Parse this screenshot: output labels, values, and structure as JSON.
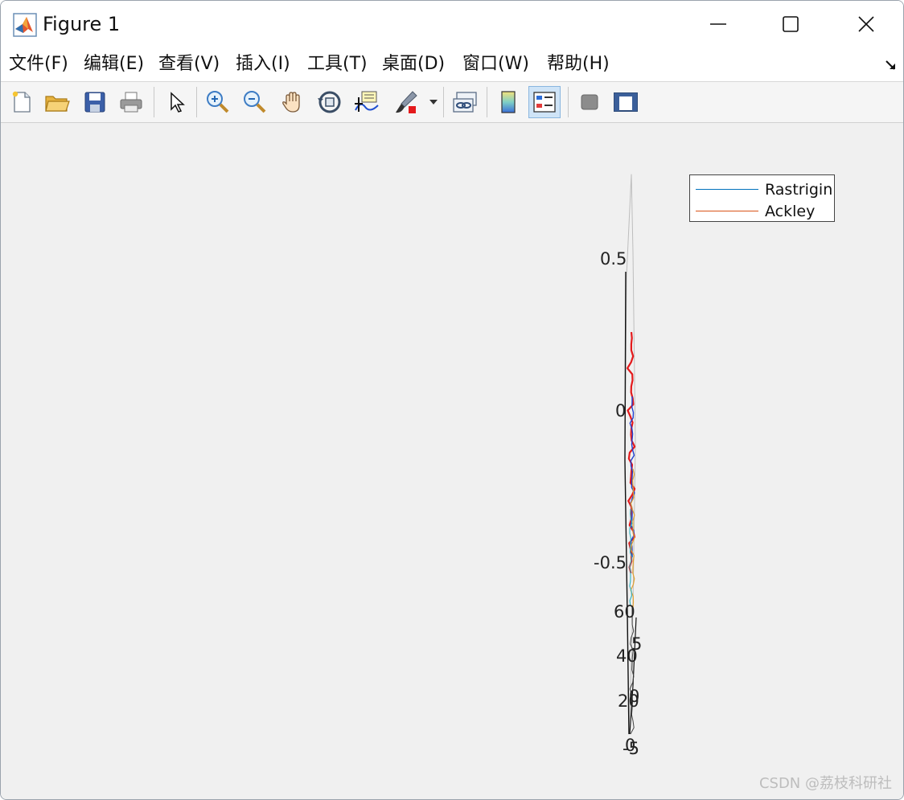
{
  "window": {
    "title": "Figure 1"
  },
  "menu": {
    "items": [
      {
        "label": "文件(F)"
      },
      {
        "label": "编辑(E)"
      },
      {
        "label": "查看(V)"
      },
      {
        "label": "插入(I)"
      },
      {
        "label": "工具(T)"
      },
      {
        "label": "桌面(D)"
      },
      {
        "label": "窗口(W)"
      },
      {
        "label": "帮助(H)"
      }
    ]
  },
  "toolbar": {
    "icons": [
      "new-figure-icon",
      "open-file-icon",
      "save-icon",
      "print-icon",
      "pointer-icon",
      "zoom-in-icon",
      "zoom-out-icon",
      "pan-icon",
      "rotate-3d-icon",
      "data-cursor-icon",
      "brush-icon",
      "link-plot-icon",
      "colorbar-icon",
      "legend-icon",
      "hide-plot-tools-icon",
      "show-plot-tools-icon"
    ],
    "active": "legend-icon"
  },
  "chart_data": {
    "type": "line",
    "series": [
      {
        "name": "Rastrigin",
        "color": "#0072BD"
      },
      {
        "name": "Ackley",
        "color": "#D95319"
      }
    ],
    "z_ticks": [
      "0.5",
      "0",
      "-0.5"
    ],
    "y_ticks": [
      "60",
      "40",
      "20",
      "0"
    ],
    "x_ticks": [
      "5",
      "0",
      "-5"
    ],
    "legend_position": "top-right"
  },
  "watermark": "CSDN @荔枝科研社"
}
